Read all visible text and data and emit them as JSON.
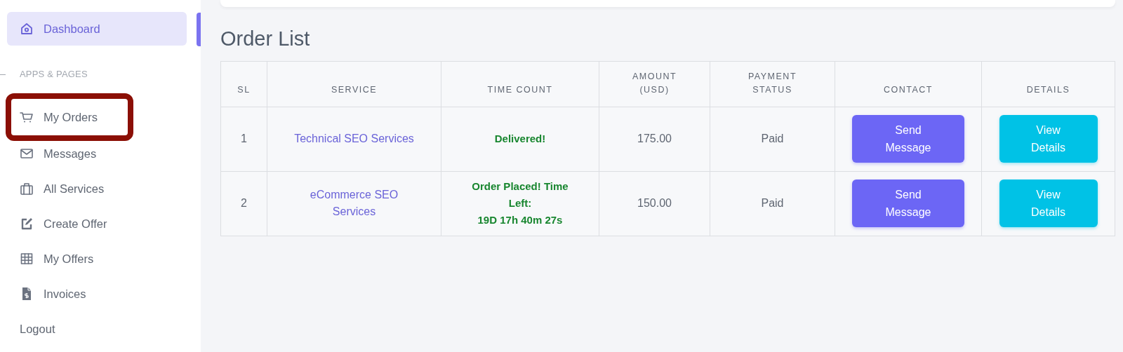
{
  "sidebar": {
    "items": [
      {
        "kind": "link",
        "label": "Dashboard",
        "selected": true,
        "highlighted": false
      },
      {
        "kind": "section",
        "label": "APPS & PAGES"
      },
      {
        "kind": "link",
        "label": "My Orders",
        "selected": false,
        "highlighted": true
      },
      {
        "kind": "link",
        "label": "Messages",
        "selected": false,
        "highlighted": false
      },
      {
        "kind": "link",
        "label": "All Services",
        "selected": false,
        "highlighted": false
      },
      {
        "kind": "link",
        "label": "Create Offer",
        "selected": false,
        "highlighted": false
      },
      {
        "kind": "link",
        "label": "My Offers",
        "selected": false,
        "highlighted": false
      },
      {
        "kind": "link",
        "label": "Invoices",
        "selected": false,
        "highlighted": false
      },
      {
        "kind": "link",
        "label": "Logout",
        "selected": false,
        "highlighted": false
      }
    ]
  },
  "page_title": "Order List",
  "table": {
    "columns": [
      "SL",
      "SERVICE",
      "TIME COUNT",
      "AMOUNT (USD)",
      "PAYMENT STATUS",
      "CONTACT",
      "DETAILS"
    ],
    "rows": [
      {
        "sl": "1",
        "service": "Technical SEO Services",
        "time_count": [
          "Delivered!"
        ],
        "amount": "175.00",
        "payment_status": "Paid",
        "contact": "Send Message",
        "details": "View Details"
      },
      {
        "sl": "2",
        "service": "eCommerce SEO Services",
        "time_count": [
          "Order Placed! Time Left:",
          "19D 17h 40m 27s"
        ],
        "amount": "150.00",
        "payment_status": "Paid",
        "contact": "Send Message",
        "details": "View Details"
      }
    ]
  }
}
